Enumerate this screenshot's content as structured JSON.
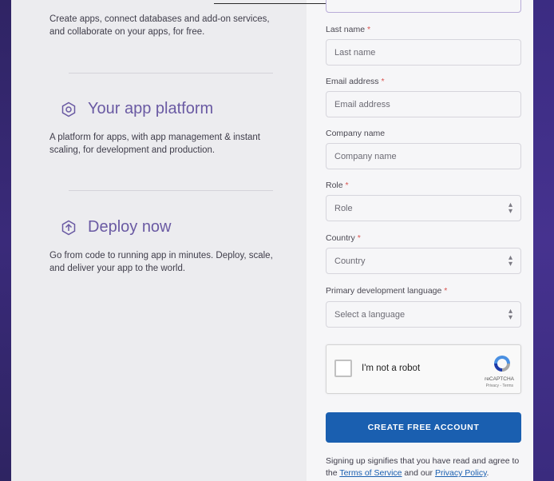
{
  "left": {
    "intro": "Create apps, connect databases and add-on services, and collaborate on your apps, for free.",
    "features": [
      {
        "title": "Your app platform",
        "description": "A platform for apps, with app management & instant scaling, for development and production.",
        "icon": "hexagon-icon"
      },
      {
        "title": "Deploy now",
        "description": "Go from code to running app in minutes. Deploy, scale, and deliver your app to the world.",
        "icon": "upload-arrow-icon"
      }
    ]
  },
  "form": {
    "last_name": {
      "label": "Last name",
      "placeholder": "Last name",
      "required": "*"
    },
    "email": {
      "label": "Email address",
      "placeholder": "Email address",
      "required": "*"
    },
    "company": {
      "label": "Company name",
      "placeholder": "Company name"
    },
    "role": {
      "label": "Role",
      "value": "Role",
      "required": "*"
    },
    "country": {
      "label": "Country",
      "value": "Country",
      "required": "*"
    },
    "language": {
      "label": "Primary development language",
      "value": "Select a language",
      "required": "*"
    },
    "captcha": {
      "label": "I'm not a robot",
      "brand": "reCAPTCHA",
      "links": "Privacy - Terms"
    },
    "submit_label": "CREATE FREE ACCOUNT",
    "legal": {
      "prefix": "Signing up signifies that you have read and agree to the ",
      "terms": "Terms of Service",
      "middle": " and our ",
      "privacy": "Privacy Policy",
      "suffix": "."
    }
  },
  "colors": {
    "accent": "#6a5aa3",
    "button": "#1a5fb0",
    "required": "#d9534f",
    "frame": "#3b2a78"
  }
}
